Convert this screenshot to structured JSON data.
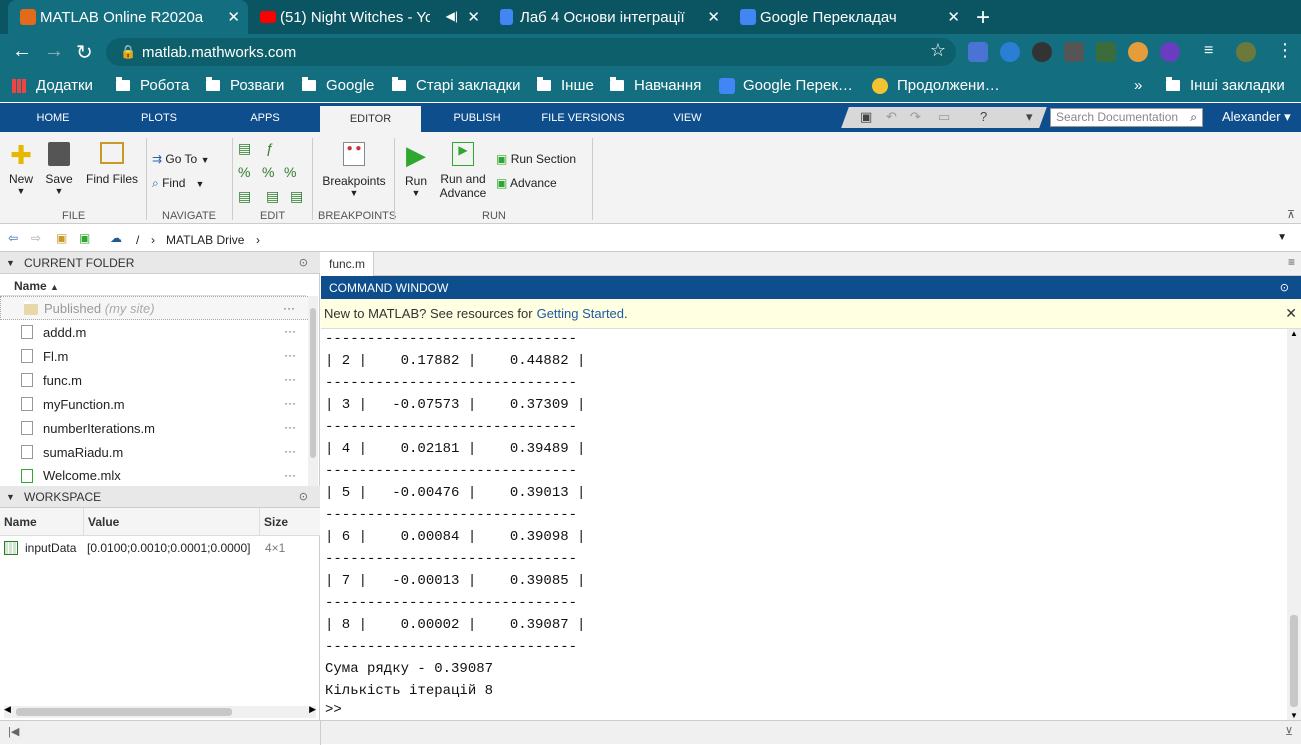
{
  "browser": {
    "tabs": [
      {
        "title": "MATLAB Online R2020a",
        "color": "#e16a1b"
      },
      {
        "title": "(51) Night Witches - Yo",
        "color": "#ff0000"
      },
      {
        "title": "Лаб 4 Основи інтеграції",
        "color": "#4285f4"
      },
      {
        "title": "Google Перекладач",
        "color": "#4285f4"
      }
    ],
    "new_tab": "+",
    "url": "matlab.mathworks.com",
    "bookmarks": [
      "Додатки",
      "Робота",
      "Розваги",
      "Google",
      "Старі закладки",
      "Інше",
      "Навчання",
      "Google Перек…",
      "Продолжени…"
    ],
    "other_bookmarks": "Інші закладки",
    "more": "»"
  },
  "matlab": {
    "main_tabs": [
      "HOME",
      "PLOTS",
      "APPS",
      "EDITOR",
      "PUBLISH",
      "FILE VERSIONS",
      "VIEW"
    ],
    "selected_tab": "EDITOR",
    "search_placeholder": "Search Documentation",
    "user": "Alexander",
    "ribbon": {
      "new": "New",
      "save": "Save",
      "find_files": "Find Files",
      "go_to": "Go To",
      "find": "Find",
      "breakpoints": "Breakpoints",
      "run": "Run",
      "run_and_advance_1": "Run and",
      "run_and_advance_2": "Advance",
      "run_section": "Run Section",
      "advance": "Advance",
      "sections": {
        "file": "FILE",
        "navigate": "NAVIGATE",
        "edit": "EDIT",
        "breakpoints": "BREAKPOINTS",
        "run": "RUN"
      }
    },
    "breadcrumb": {
      "root": "/",
      "folder": "MATLAB Drive"
    },
    "current_folder": {
      "title": "CURRENT FOLDER",
      "column": "Name",
      "published": "Published",
      "published_note": "(my site)",
      "files": [
        "addd.m",
        "Fl.m",
        "func.m",
        "myFunction.m",
        "numberIterations.m",
        "sumaRiadu.m",
        "Welcome.mlx"
      ],
      "more": "···"
    },
    "workspace": {
      "title": "WORKSPACE",
      "columns": [
        "Name",
        "Value",
        "Size"
      ],
      "rows": [
        {
          "name": "inputData",
          "value": "[0.0100;0.0010;0.0001;0.0000]",
          "size": "4×1"
        }
      ]
    },
    "editor_tab": "func.m",
    "command_window": {
      "title": "COMMAND WINDOW",
      "notice_text": "New to MATLAB? See resources for ",
      "notice_link": "Getting Started",
      "notice_end": ".",
      "lines": [
        "------------------------------",
        "| 2 |    0.17882 |    0.44882 |",
        "------------------------------",
        "| 3 |   -0.07573 |    0.37309 |",
        "------------------------------",
        "| 4 |    0.02181 |    0.39489 |",
        "------------------------------",
        "| 5 |   -0.00476 |    0.39013 |",
        "------------------------------",
        "| 6 |    0.00084 |    0.39098 |",
        "------------------------------",
        "| 7 |   -0.00013 |    0.39085 |",
        "------------------------------",
        "| 8 |    0.00002 |    0.39087 |",
        "------------------------------",
        "Сума рядку - 0.39087",
        "Кількість ітерацій 8",
        ">>"
      ]
    }
  }
}
